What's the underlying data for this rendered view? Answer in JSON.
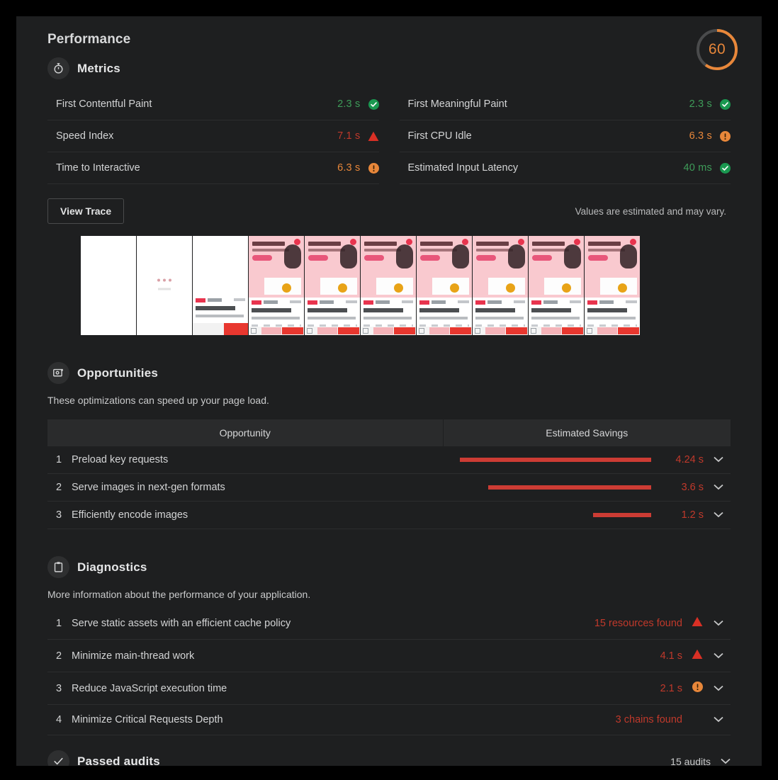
{
  "header": {
    "title": "Performance",
    "score": "60",
    "score_color": "#e8873a",
    "score_value": 60
  },
  "metrics": {
    "section_title": "Metrics",
    "icon": "stopwatch-icon",
    "left_column": [
      {
        "label": "First Contentful Paint",
        "value": "2.3 s",
        "status": "pass",
        "icon": "check-circle-icon",
        "color": "#3e9c59"
      },
      {
        "label": "Speed Index",
        "value": "7.1 s",
        "status": "fail",
        "icon": "warning-triangle-icon",
        "color": "#c0392b"
      },
      {
        "label": "Time to Interactive",
        "value": "6.3 s",
        "status": "average",
        "icon": "info-circle-icon",
        "color": "#e8873a"
      }
    ],
    "right_column": [
      {
        "label": "First Meaningful Paint",
        "value": "2.3 s",
        "status": "pass",
        "icon": "check-circle-icon",
        "color": "#3e9c59"
      },
      {
        "label": "First CPU Idle",
        "value": "6.3 s",
        "status": "average",
        "icon": "info-circle-icon",
        "color": "#e8873a"
      },
      {
        "label": "Estimated Input Latency",
        "value": "40 ms",
        "status": "pass",
        "icon": "check-circle-icon",
        "color": "#3e9c59"
      }
    ],
    "view_trace_label": "View Trace",
    "estimated_note": "Values are estimated and may vary."
  },
  "filmstrip": {
    "frames": [
      {
        "state": "blank"
      },
      {
        "state": "spinner"
      },
      {
        "state": "partial"
      },
      {
        "state": "loaded"
      },
      {
        "state": "loaded"
      },
      {
        "state": "loaded"
      },
      {
        "state": "loaded"
      },
      {
        "state": "loaded"
      },
      {
        "state": "loaded"
      },
      {
        "state": "loaded"
      }
    ]
  },
  "opportunities": {
    "section_title": "Opportunities",
    "icon": "image-opportunity-icon",
    "description": "These optimizations can speed up your page load.",
    "columns": {
      "name": "Opportunity",
      "savings": "Estimated Savings"
    },
    "rows": [
      {
        "index": "1",
        "title": "Preload key requests",
        "value": "4.24 s",
        "bar_pct": 100,
        "chevron": "chevron-down-icon"
      },
      {
        "index": "2",
        "title": "Serve images in next-gen formats",
        "value": "3.6 s",
        "bar_pct": 85,
        "chevron": "chevron-down-icon"
      },
      {
        "index": "3",
        "title": "Efficiently encode images",
        "value": "1.2 s",
        "bar_pct": 30,
        "chevron": "chevron-down-icon"
      }
    ]
  },
  "diagnostics": {
    "section_title": "Diagnostics",
    "icon": "clipboard-icon",
    "description": "More information about the performance of your application.",
    "rows": [
      {
        "index": "1",
        "title": "Serve static assets with an efficient cache policy",
        "value": "15 resources found",
        "status": "fail",
        "icon": "warning-triangle-icon",
        "chevron": "chevron-down-icon"
      },
      {
        "index": "2",
        "title": "Minimize main-thread work",
        "value": "4.1 s",
        "status": "fail",
        "icon": "warning-triangle-icon",
        "chevron": "chevron-down-icon"
      },
      {
        "index": "3",
        "title": "Reduce JavaScript execution time",
        "value": "2.1 s",
        "status": "average",
        "icon": "info-circle-icon",
        "chevron": "chevron-down-icon"
      },
      {
        "index": "4",
        "title": "Minimize Critical Requests Depth",
        "value": "3 chains found",
        "status": "none",
        "icon": "",
        "chevron": "chevron-down-icon"
      }
    ]
  },
  "passed_audits": {
    "title": "Passed audits",
    "icon": "check-icon",
    "count": "15 audits",
    "chevron": "chevron-down-icon"
  },
  "colors": {
    "background": "#000000",
    "panel": "#1e1f20",
    "pass": "#3e9c59",
    "average": "#e8873a",
    "fail": "#c0392b",
    "bar": "#cc3c34"
  }
}
